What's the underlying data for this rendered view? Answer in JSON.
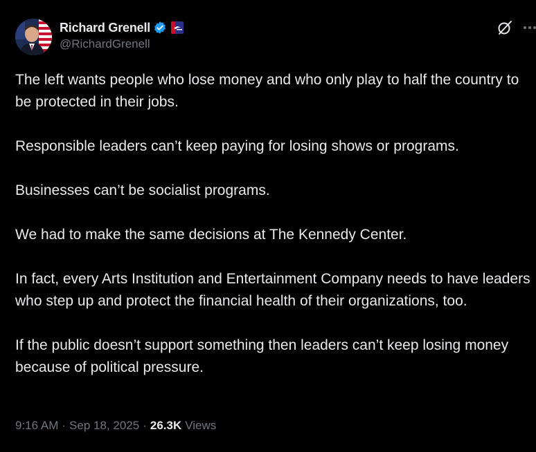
{
  "author": {
    "display_name": "Richard Grenell",
    "handle": "@RichardGrenell",
    "avatar_icon": "avatar-photo",
    "verified_icon": "verified-badge-icon",
    "affiliate_icon": "organization-badge-icon"
  },
  "actions": {
    "grok_icon": "grok-icon",
    "more_icon": "more-icon"
  },
  "tweet": {
    "paragraphs": [
      "The left wants people who lose money and who only play to half the country to be protected in their jobs.",
      "Responsible leaders can’t keep paying for losing shows or programs.",
      "Businesses can’t be socialist programs.",
      "We had to make the same decisions at The Kennedy Center.",
      "In fact, every Arts Institution and Entertainment Company needs to have leaders who step up and protect the financial health of their organizations, too.",
      "If the public doesn’t support something then leaders can’t keep losing money because of political pressure."
    ]
  },
  "meta": {
    "time": "9:16 AM",
    "separator": "·",
    "date": "Sep 18, 2025",
    "views_count": "26.3K",
    "views_label": "Views"
  },
  "colors": {
    "background": "#000000",
    "text": "#e7e9ea",
    "secondary": "#71767b",
    "verified": "#1d9bf0"
  }
}
